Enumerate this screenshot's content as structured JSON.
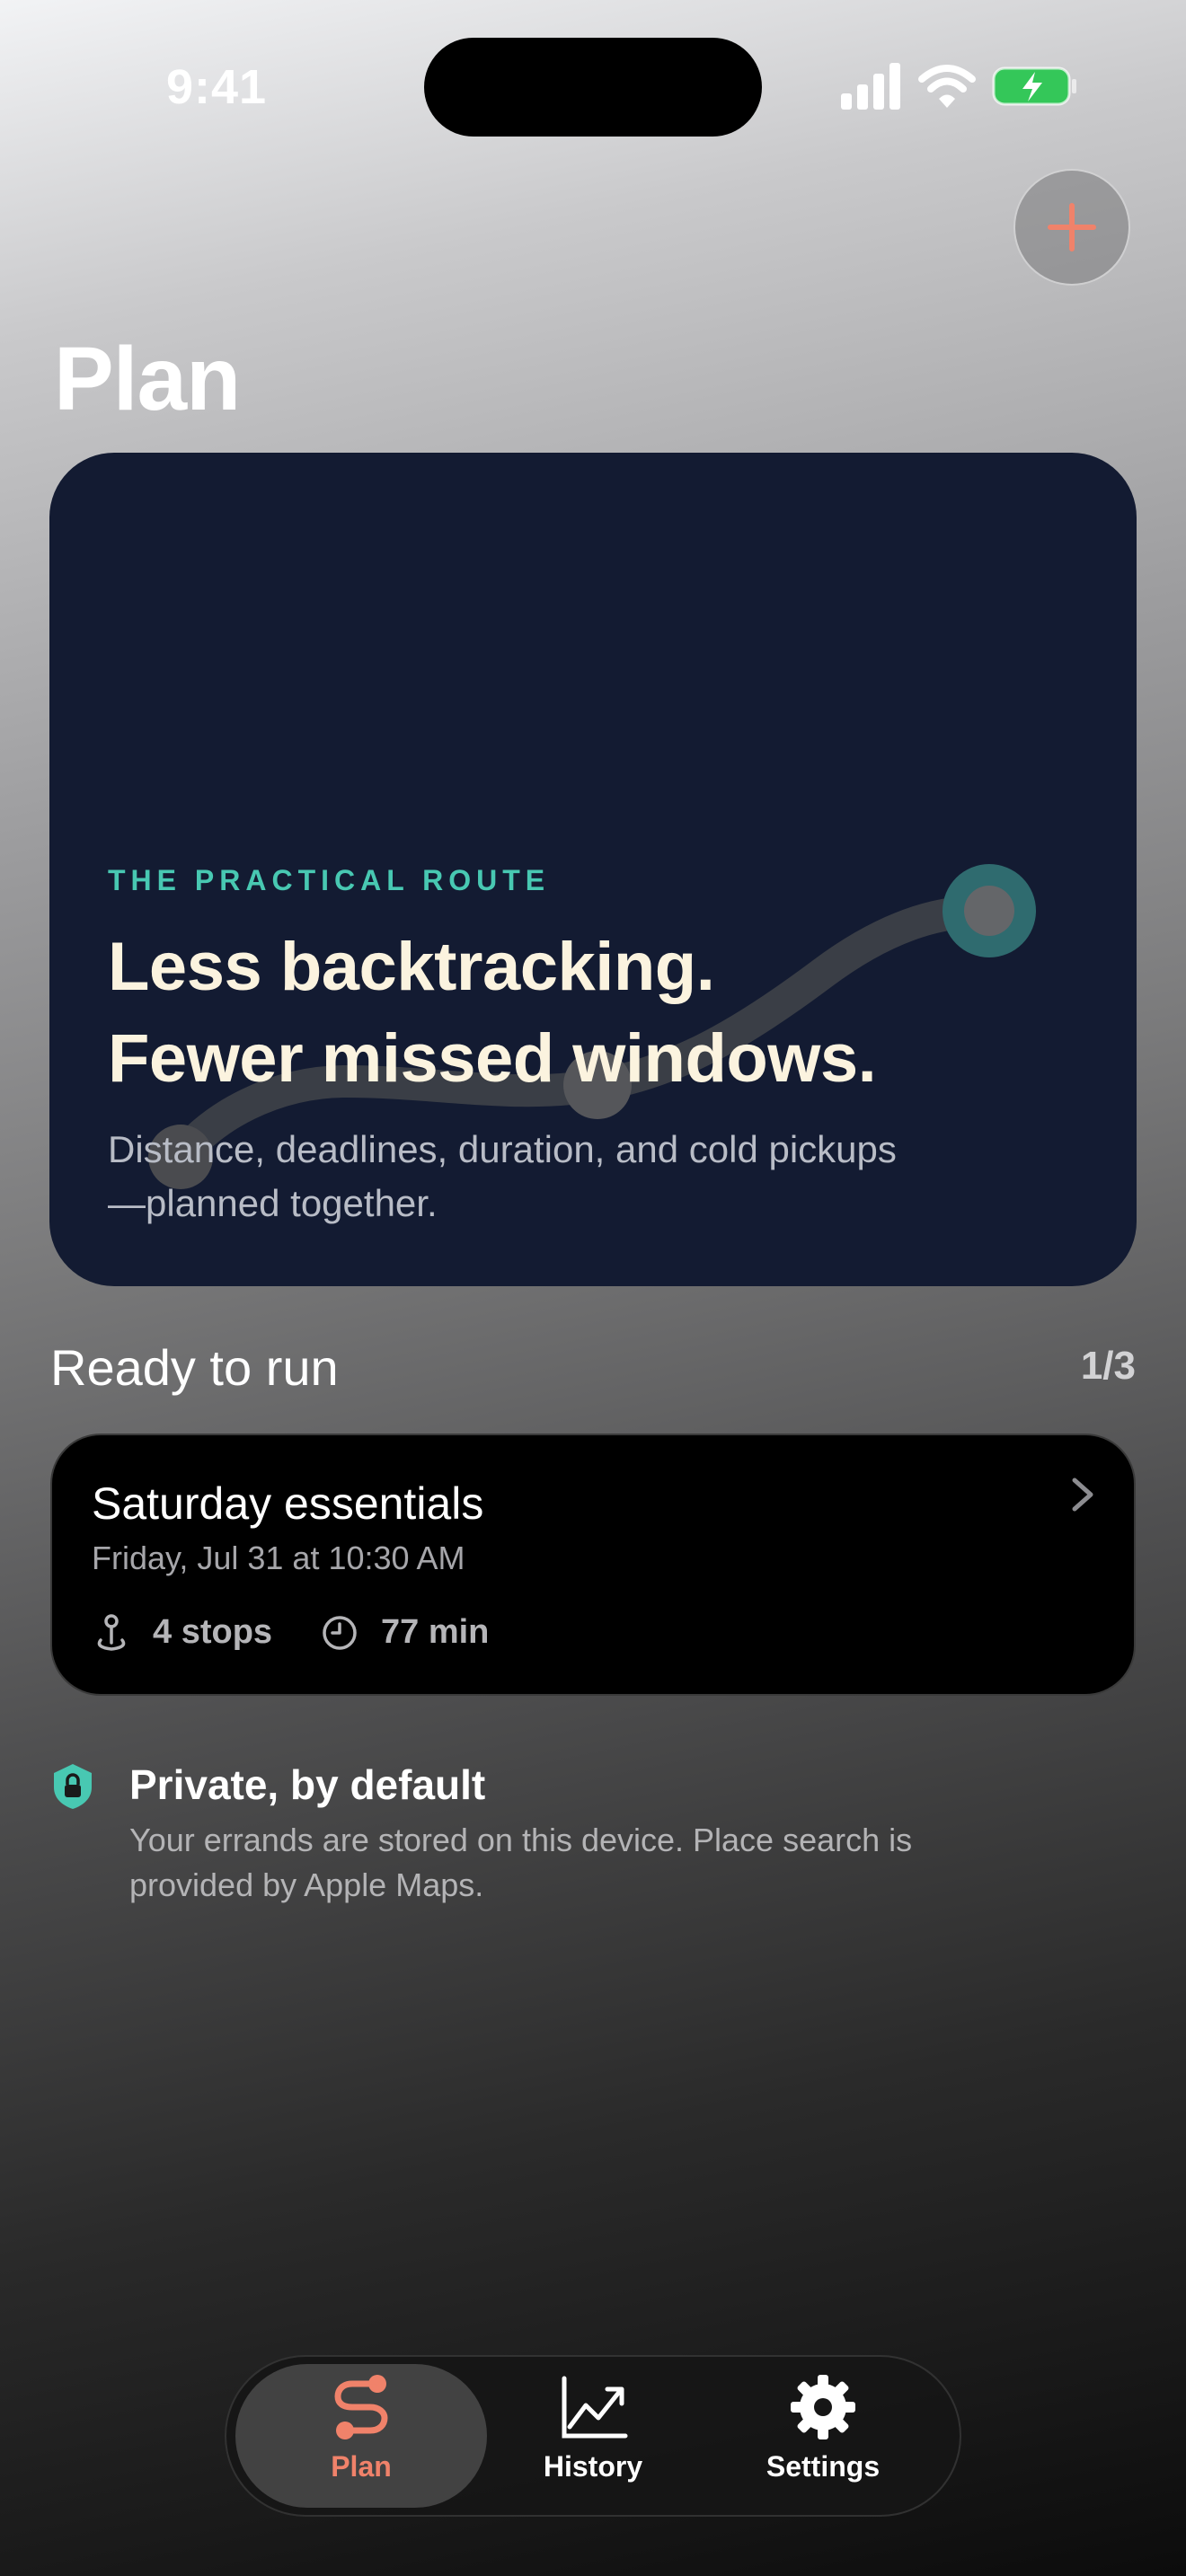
{
  "status_bar": {
    "time": "9:41",
    "battery_color": "#34c759"
  },
  "header": {
    "title": "Plan",
    "add_button_icon": "plus-icon",
    "accent_color": "#f0826a"
  },
  "hero": {
    "eyebrow": "THE PRACTICAL ROUTE",
    "headline_line1": "Less backtracking.",
    "headline_line2": "Fewer missed windows.",
    "subtitle": "Distance, deadlines, duration, and cold pickups—planned together.",
    "background_color": "#131b32",
    "eyebrow_color": "#48c8b2"
  },
  "ready_to_run": {
    "title": "Ready to run",
    "count": "1/3",
    "card": {
      "title": "Saturday essentials",
      "date": "Friday, Jul 31 at 10:30 AM",
      "stops": "4 stops",
      "duration": "77 min",
      "stops_icon": "map-pin-icon",
      "duration_icon": "clock-icon"
    }
  },
  "privacy": {
    "title": "Private, by default",
    "body": "Your errands are stored on this device. Place search is provided by Apple Maps.",
    "icon": "shield-lock-icon"
  },
  "tab_bar": {
    "selected": "Plan",
    "tabs": [
      {
        "label": "Plan",
        "icon": "route-icon"
      },
      {
        "label": "History",
        "icon": "chart-icon"
      },
      {
        "label": "Settings",
        "icon": "gear-icon"
      }
    ]
  }
}
